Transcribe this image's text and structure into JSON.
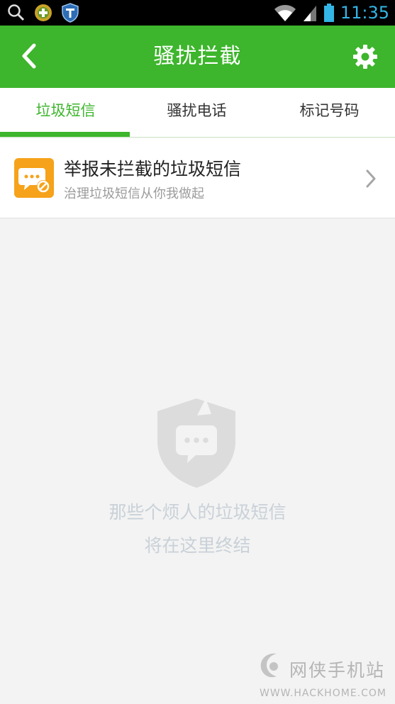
{
  "status_bar": {
    "time": "11:35",
    "icons": [
      "search-icon",
      "game-center-icon",
      "shield-t-icon",
      "wifi-icon",
      "signal-icon",
      "battery-icon"
    ]
  },
  "app_bar": {
    "title": "骚扰拦截",
    "back_icon": "chevron-left-icon",
    "settings_icon": "gear-icon"
  },
  "tabs": [
    {
      "label": "垃圾短信",
      "active": true
    },
    {
      "label": "骚扰电话",
      "active": false
    },
    {
      "label": "标记号码",
      "active": false
    }
  ],
  "report": {
    "title": "举报未拦截的垃圾短信",
    "subtitle": "治理垃圾短信从你我做起",
    "icon": "report-sms-icon"
  },
  "empty_state": {
    "line1": "那些个烦人的垃圾短信",
    "line2": "将在这里终结",
    "icon": "shield-message-icon"
  },
  "watermark": {
    "cn": "网侠手机站",
    "en": "WWW.HACKHOME.COM"
  },
  "colors": {
    "primary_green": "#3db52c",
    "status_time": "#33b5e5",
    "report_icon_bg": "#f6a21a",
    "empty_text": "#c9d1d8"
  }
}
